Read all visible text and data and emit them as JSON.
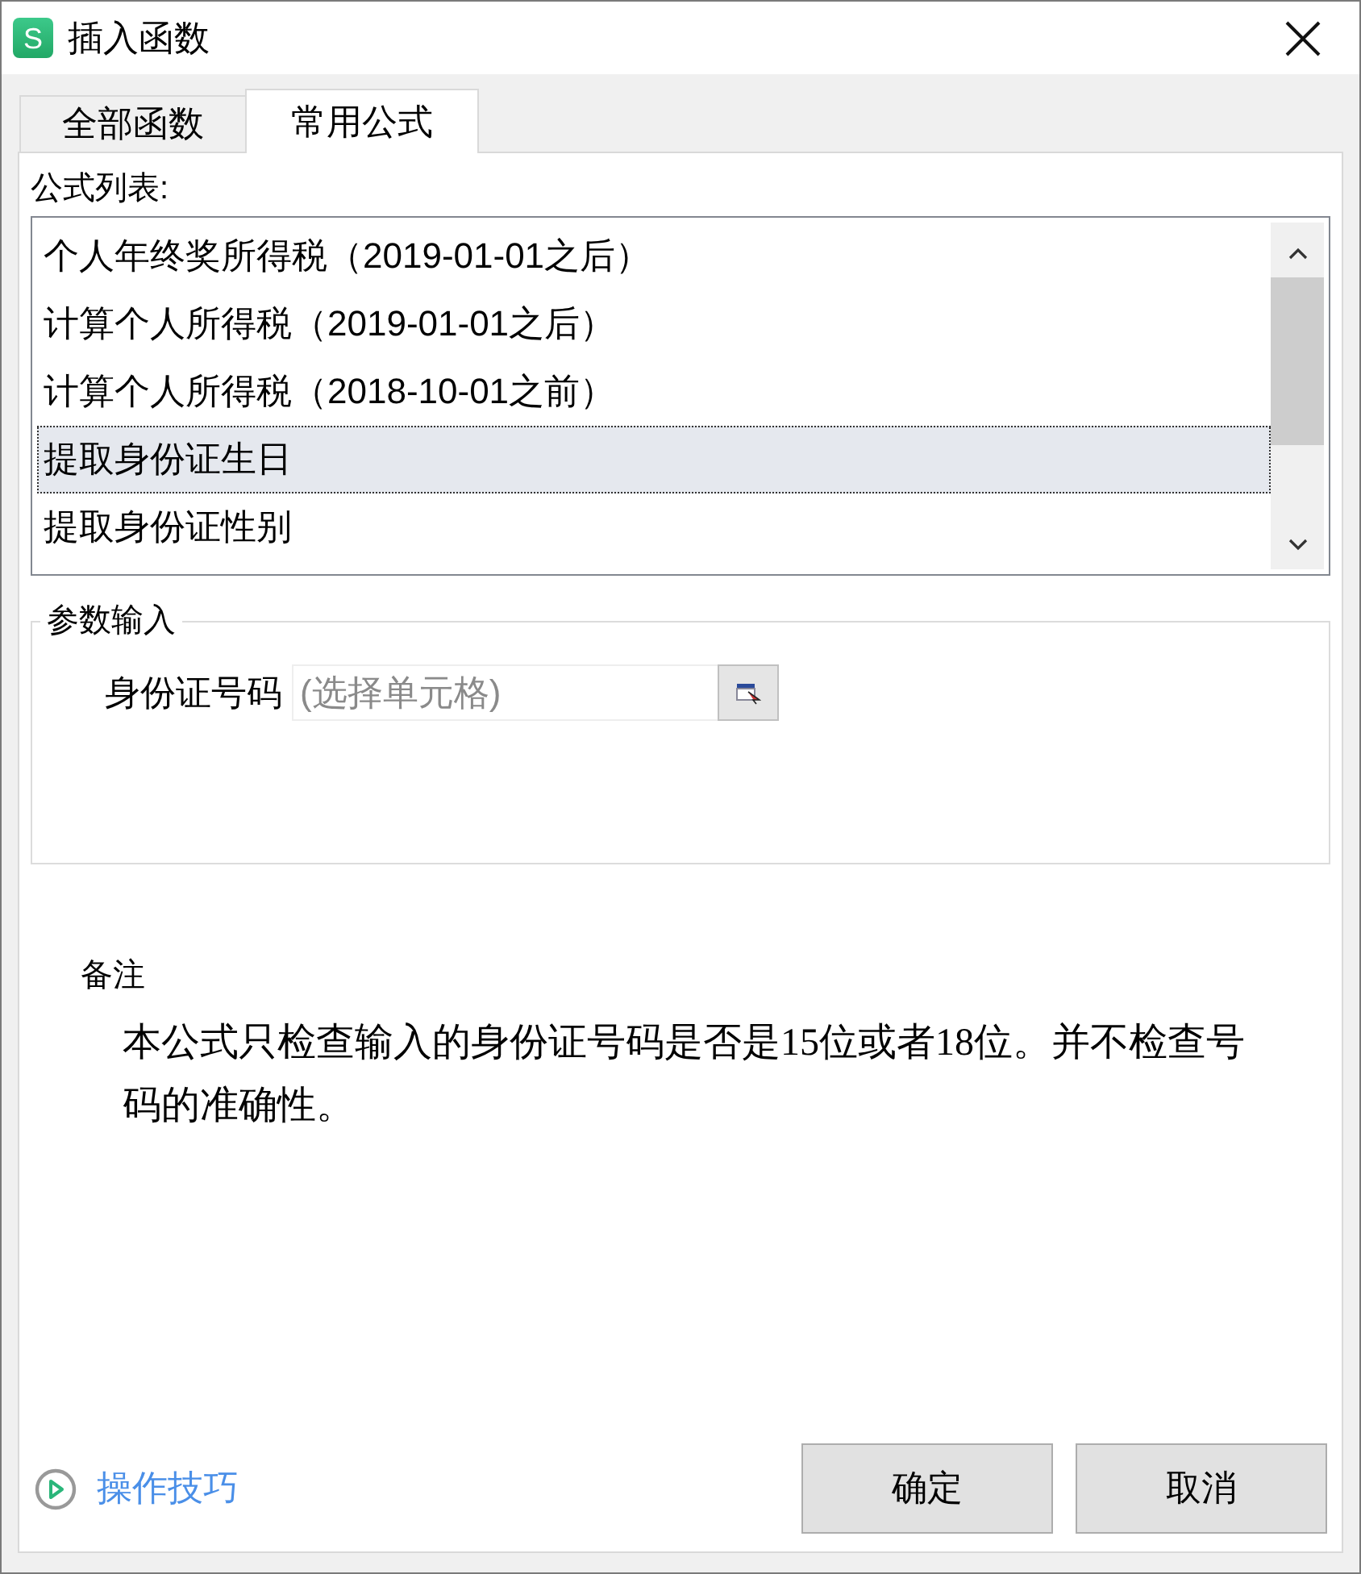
{
  "window": {
    "logo": "S",
    "title": "插入函数"
  },
  "tabs": [
    {
      "label": "全部函数",
      "selected": false
    },
    {
      "label": "常用公式",
      "selected": true
    }
  ],
  "formula_list": {
    "label": "公式列表:",
    "items": [
      {
        "label": "个人年终奖所得税（2019-01-01之后）",
        "selected": false
      },
      {
        "label": "计算个人所得税（2019-01-01之后）",
        "selected": false
      },
      {
        "label": "计算个人所得税（2018-10-01之前）",
        "selected": false
      },
      {
        "label": "提取身份证生日",
        "selected": true
      },
      {
        "label": "提取身份证性别",
        "selected": false
      }
    ]
  },
  "parameters": {
    "legend": "参数输入",
    "fields": [
      {
        "label": "身份证号码",
        "placeholder": "(选择单元格)"
      }
    ]
  },
  "note": {
    "heading": "备注",
    "text": "本公式只检查输入的身份证号码是否是15位或者18位。并不检查号码的准确性。"
  },
  "footer": {
    "tips_link": "操作技巧",
    "buttons": [
      "确定",
      "取消"
    ]
  }
}
